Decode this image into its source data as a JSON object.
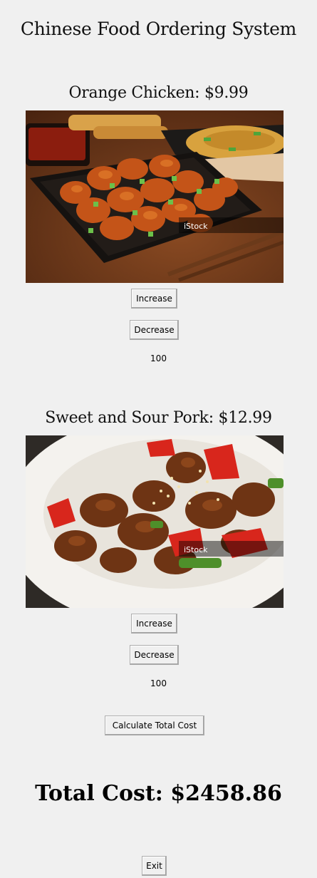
{
  "app": {
    "title": "Chinese Food Ordering System"
  },
  "items": [
    {
      "title": "Orange Chicken: $9.99",
      "image_watermark": "iStock",
      "increase_label": "Increase",
      "decrease_label": "Decrease",
      "quantity": "100"
    },
    {
      "title": "Sweet and Sour Pork: $12.99",
      "image_watermark": "iStock",
      "increase_label": "Increase",
      "decrease_label": "Decrease",
      "quantity": "100"
    }
  ],
  "actions": {
    "calculate_label": "Calculate Total Cost",
    "exit_label": "Exit"
  },
  "total": {
    "text": "Total Cost: $2458.86"
  },
  "colors": {
    "window_bg": "#f0f0f0",
    "button_border": "#adadad"
  }
}
